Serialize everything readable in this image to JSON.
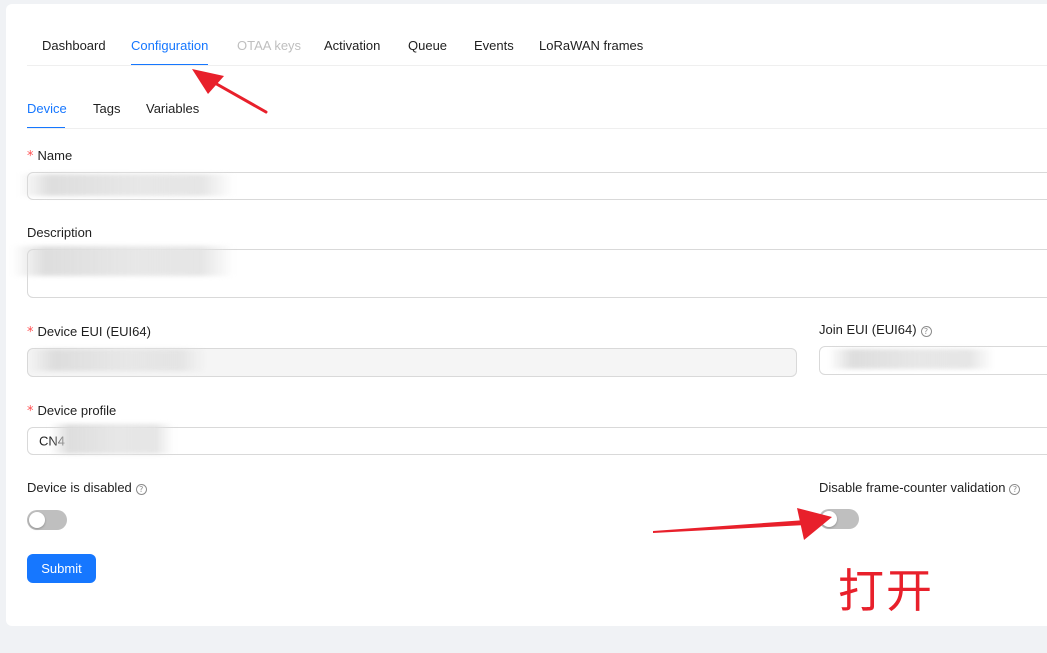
{
  "top_tabs": [
    {
      "label": "Dashboard",
      "state": "normal"
    },
    {
      "label": "Configuration",
      "state": "active"
    },
    {
      "label": "OTAA keys",
      "state": "disabled"
    },
    {
      "label": "Activation",
      "state": "normal"
    },
    {
      "label": "Queue",
      "state": "normal"
    },
    {
      "label": "Events",
      "state": "normal"
    },
    {
      "label": "LoRaWAN frames",
      "state": "normal"
    }
  ],
  "sub_tabs": [
    {
      "label": "Device",
      "state": "active"
    },
    {
      "label": "Tags",
      "state": "normal"
    },
    {
      "label": "Variables",
      "state": "normal"
    }
  ],
  "form": {
    "required_mark": "*",
    "name": {
      "label": "Name",
      "value": ""
    },
    "description": {
      "label": "Description",
      "value": ""
    },
    "device_eui": {
      "label": "Device EUI (EUI64)",
      "value": ""
    },
    "join_eui": {
      "label": "Join EUI (EUI64)",
      "value": ""
    },
    "device_profile": {
      "label": "Device profile",
      "value": "CN4"
    },
    "device_disabled": {
      "label": "Device is disabled",
      "checked": false
    },
    "disable_fcnt": {
      "label": "Disable frame-counter validation",
      "checked": false
    },
    "help_glyph": "?",
    "submit_label": "Submit"
  },
  "annotation": {
    "text": "打开",
    "color": "#e8202b"
  },
  "colors": {
    "primary": "#1677ff",
    "required": "#ff4d4f",
    "switch_off": "#bfbfbf"
  }
}
